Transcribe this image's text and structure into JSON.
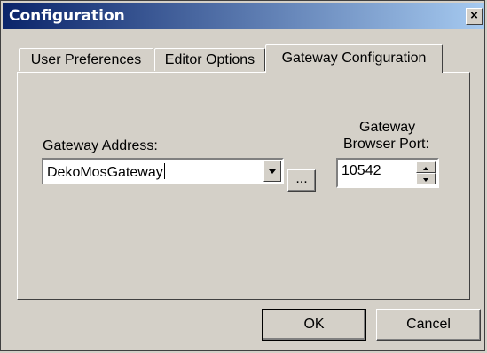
{
  "window": {
    "title": "Configuration",
    "close_glyph": "×"
  },
  "tabs": [
    {
      "label": "User Preferences",
      "active": false
    },
    {
      "label": "Editor Options",
      "active": false
    },
    {
      "label": "Gateway Configuration",
      "active": true
    }
  ],
  "gateway": {
    "address_label": "Gateway Address:",
    "address_value": "DekoMosGateway",
    "browse_label": "...",
    "port_label_line1": "Gateway",
    "port_label_line2": "Browser Port:",
    "port_value": "10542"
  },
  "buttons": {
    "ok": "OK",
    "cancel": "Cancel"
  }
}
